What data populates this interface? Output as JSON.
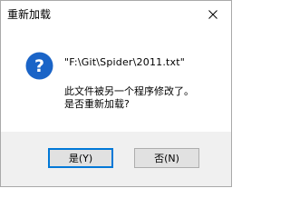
{
  "window": {
    "title": "重新加载",
    "close_icon": "close-icon"
  },
  "message": {
    "icon": "question-icon",
    "icon_color": "#1a64c7",
    "path": "\"F:\\Git\\Spider\\2011.txt\"",
    "line1": "此文件被另一个程序修改了。",
    "line2": "是否重新加载?"
  },
  "buttons": {
    "yes_label": "是(Y)",
    "no_label": "否(N)",
    "default_accent": "#0078d7"
  }
}
